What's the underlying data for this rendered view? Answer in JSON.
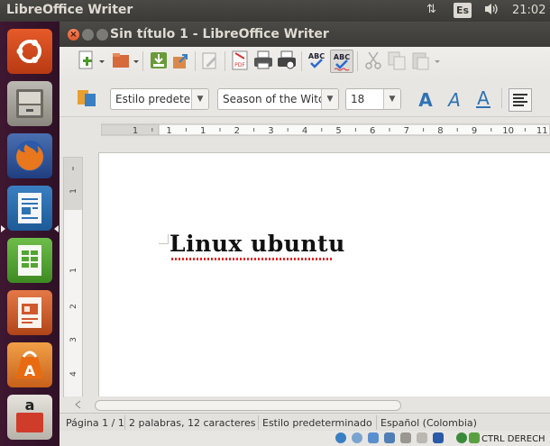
{
  "panel": {
    "app_title": "LibreOffice Writer",
    "keyboard": "Es",
    "time": "21:02",
    "sort_icon": "⇅",
    "volume_icon": "🔈"
  },
  "launcher": {
    "items": [
      {
        "name": "ubuntu-dash",
        "icon": "ubuntu-logo-icon",
        "color": "#dd4814"
      },
      {
        "name": "files",
        "icon": "file-cabinet-icon",
        "color": "#9a9790"
      },
      {
        "name": "firefox",
        "icon": "firefox-icon",
        "color": "#e8771d"
      },
      {
        "name": "writer",
        "icon": "writer-icon",
        "color": "#2e73b5"
      },
      {
        "name": "calc",
        "icon": "calc-icon",
        "color": "#53a631"
      },
      {
        "name": "impress",
        "icon": "impress-icon",
        "color": "#d1582c"
      },
      {
        "name": "software-center",
        "icon": "software-center-icon",
        "color": "#e0771f"
      },
      {
        "name": "amazon",
        "icon": "amazon-icon",
        "color": "#d03c2a"
      }
    ],
    "amazon_label": "a"
  },
  "window": {
    "title": "Sin título 1 - LibreOffice Writer",
    "close": "×"
  },
  "format_toolbar": {
    "paragraph_style": "Estilo predete",
    "font_name": "Season of the Witc",
    "font_size": "18",
    "dropdown_arrow": "▼",
    "letter_a": "A"
  },
  "ruler": {
    "ticks": [
      "1",
      "1",
      "1",
      "2",
      "3",
      "4",
      "5",
      "6",
      "7",
      "8",
      "9",
      "10",
      "11"
    ]
  },
  "document": {
    "text": "Linux ubuntu"
  },
  "statusbar": {
    "page": "Página 1 / 1",
    "words": "2 palabras, 12 caracteres",
    "style": "Estilo predeterminado",
    "language": "Español (Colombia)"
  },
  "tray": {
    "text": "CTRL DERECH"
  },
  "colors": {
    "launcher_bg": "#2f1126",
    "panel_bg": "#3c3b37",
    "close_button": "#e25a2b",
    "accent_blue": "#2e73b5"
  }
}
